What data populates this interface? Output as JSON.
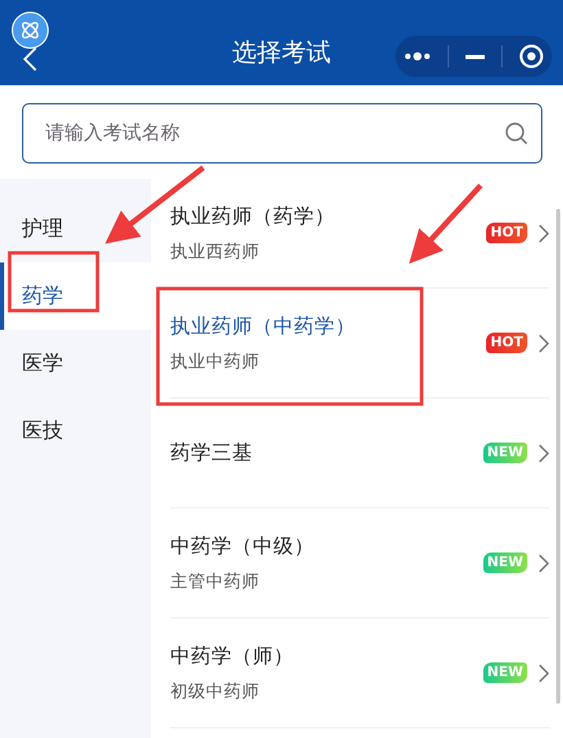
{
  "header": {
    "title": "选择考试"
  },
  "search": {
    "placeholder": "请输入考试名称"
  },
  "sidebar": {
    "items": [
      {
        "label": "护理",
        "selected": false
      },
      {
        "label": "药学",
        "selected": true
      },
      {
        "label": "医学",
        "selected": false
      },
      {
        "label": "医技",
        "selected": false
      }
    ]
  },
  "exams": [
    {
      "title": "执业药师（药学）",
      "subtitle": "执业西药师",
      "badge": "HOT",
      "kind": "hot",
      "selected": false
    },
    {
      "title": "执业药师（中药学）",
      "subtitle": "执业中药师",
      "badge": "HOT",
      "kind": "hot",
      "selected": true
    },
    {
      "title": "药学三基",
      "badge": "NEW",
      "kind": "new",
      "selected": false
    },
    {
      "title": "中药学（中级）",
      "subtitle": "主管中药师",
      "badge": "NEW",
      "kind": "new",
      "selected": false
    },
    {
      "title": "中药学（师）",
      "subtitle": "初级中药师",
      "badge": "NEW",
      "kind": "new",
      "selected": false
    }
  ]
}
